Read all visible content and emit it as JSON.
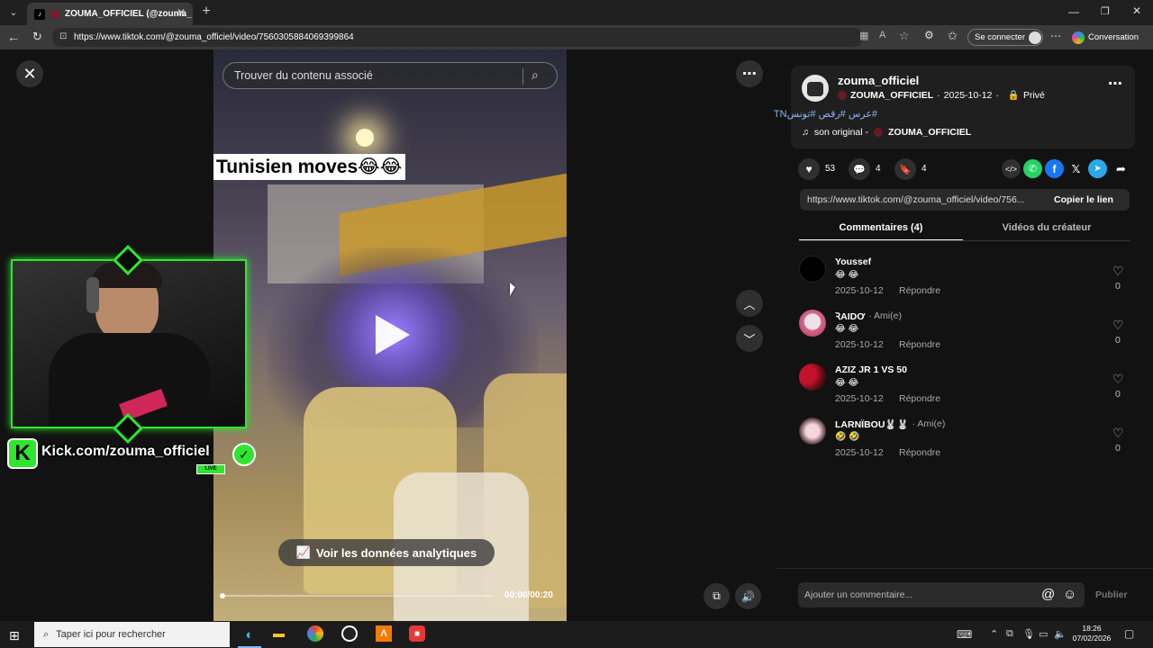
{
  "browser": {
    "tab_title": "ZOUMA_OFFICIEL (@zouma_",
    "url": "https://www.tiktok.com/@zouma_officiel/video/7560305884069399864",
    "signin": "Se connecter",
    "copilot": "Conversation"
  },
  "video": {
    "search_placeholder": "Trouver du contenu associé",
    "caption": "Tunisien moves😂😂",
    "analytics_label": "Voir les données analytiques",
    "time": "00:00/00:20",
    "progress": 0.0
  },
  "stream_overlay": {
    "kick_text": "Kick.com/zouma_officiel",
    "live_badge": "LIVE"
  },
  "post": {
    "username": "zouma_officiel",
    "display_name": "ZOUMA_OFFICIEL",
    "date": "2025-10-12",
    "privacy": "Privé",
    "hashtags": "#عرس #رقص #تونسTN",
    "sound_prefix": "son original -",
    "sound_author": "ZOUMA_OFFICIEL",
    "likes": "53",
    "comments": "4",
    "saves": "4",
    "link": "https://www.tiktok.com/@zouma_officiel/video/756...",
    "copy_link": "Copier le lien"
  },
  "tabs": {
    "comments": "Commentaires (4)",
    "creator_videos": "Vidéos du créateur"
  },
  "comments": [
    {
      "user": "Youssef",
      "tag": "",
      "text": "😂 😂",
      "date": "2025-10-12",
      "reply": "Répondre",
      "likes": "0"
    },
    {
      "user": "ꝚAIDƠ",
      "tag": "· Ami(e)",
      "text": "😂 😂",
      "date": "2025-10-12",
      "reply": "Répondre",
      "likes": "0"
    },
    {
      "user": "AZIZ JR 1 VS 50",
      "tag": "",
      "text": "😂 😂",
      "date": "2025-10-12",
      "reply": "Répondre",
      "likes": "0"
    },
    {
      "user": "LARNÏBOU🐰🐰",
      "tag": "· Ami(e)",
      "text": "🤣 🤣",
      "date": "2025-10-12",
      "reply": "Répondre",
      "likes": "0"
    }
  ],
  "comment_input": {
    "placeholder": "Ajouter un commentaire...",
    "publish": "Publier"
  },
  "taskbar": {
    "search": "Taper ici pour rechercher",
    "time": "18:26",
    "date": "07/02/2026"
  },
  "colors": {
    "accent_green": "#2ee62e",
    "link_blue": "#8ab4f8",
    "tiktok_red": "#fe2c55"
  }
}
